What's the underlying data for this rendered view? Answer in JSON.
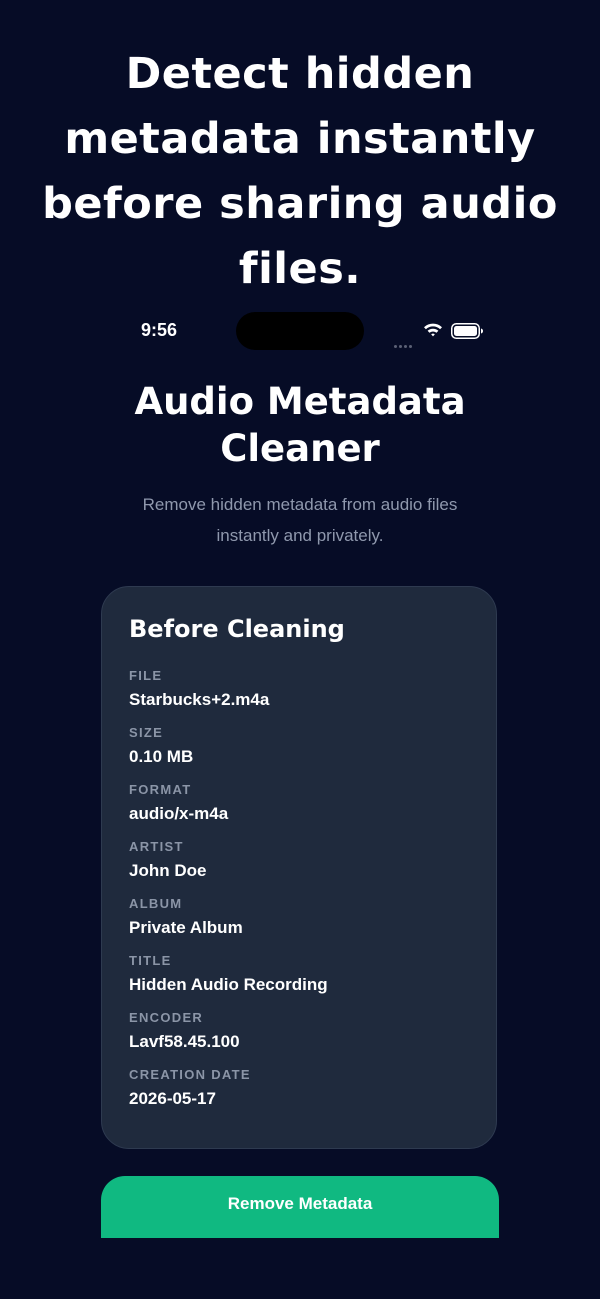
{
  "headline": "Detect hidden metadata instantly before sharing audio files.",
  "status_bar": {
    "time": "9:56",
    "icons": [
      "cellular-dots-icon",
      "wifi-icon",
      "battery-icon"
    ]
  },
  "app": {
    "title_line1": "Audio Metadata",
    "title_line2": "Cleaner",
    "subtitle_line1": "Remove hidden metadata from audio files",
    "subtitle_line2": "instantly and privately."
  },
  "card": {
    "title": "Before Cleaning",
    "fields": [
      {
        "label": "FILE",
        "value": "Starbucks+2.m4a"
      },
      {
        "label": "SIZE",
        "value": "0.10 MB"
      },
      {
        "label": "FORMAT",
        "value": "audio/x-m4a"
      },
      {
        "label": "ARTIST",
        "value": "John Doe"
      },
      {
        "label": "ALBUM",
        "value": "Private Album"
      },
      {
        "label": "TITLE",
        "value": "Hidden Audio Recording"
      },
      {
        "label": "ENCODER",
        "value": "Lavf58.45.100"
      },
      {
        "label": "CREATION DATE",
        "value": "2026-05-17"
      }
    ]
  },
  "actions": {
    "remove_label": "Remove Metadata"
  },
  "colors": {
    "background": "#060c26",
    "card": "#1f2a3d",
    "accent": "#10b981",
    "muted_text": "#8f98ad"
  }
}
